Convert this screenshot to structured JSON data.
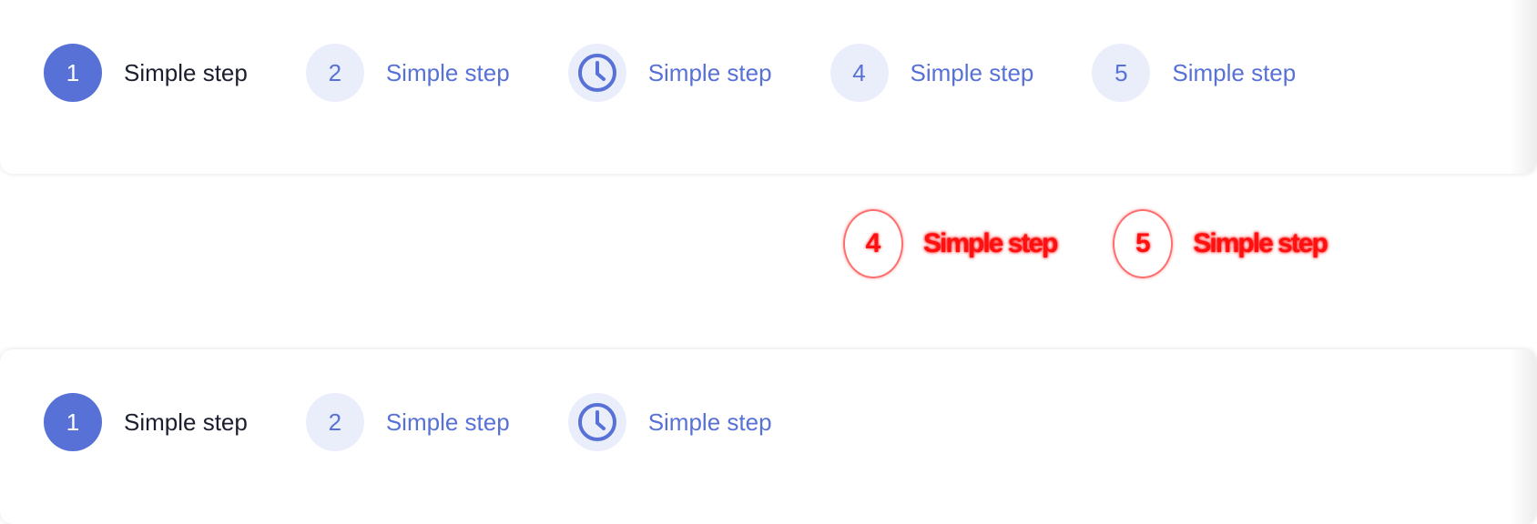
{
  "stepper_top": {
    "steps": [
      {
        "badge": "1",
        "label": "Simple step",
        "state": "active",
        "icon": null
      },
      {
        "badge": "2",
        "label": "Simple step",
        "state": "inactive",
        "icon": null
      },
      {
        "badge": "",
        "label": "Simple step",
        "state": "inactive",
        "icon": "clock-icon"
      },
      {
        "badge": "4",
        "label": "Simple step",
        "state": "inactive",
        "icon": null
      },
      {
        "badge": "5",
        "label": "Simple step",
        "state": "inactive",
        "icon": null
      }
    ]
  },
  "ghost_row": {
    "steps": [
      {
        "badge": "4",
        "label": "Simple step"
      },
      {
        "badge": "5",
        "label": "Simple step"
      }
    ]
  },
  "stepper_bottom": {
    "steps": [
      {
        "badge": "1",
        "label": "Simple step",
        "state": "active",
        "icon": null
      },
      {
        "badge": "2",
        "label": "Simple step",
        "state": "inactive",
        "icon": null
      },
      {
        "badge": "",
        "label": "Simple step",
        "state": "inactive",
        "icon": "clock-icon"
      }
    ]
  },
  "colors": {
    "accent": "#5771d6",
    "accent_soft": "#eaeefb",
    "text_dark": "#1b1e2e",
    "ghost_red": "#ff1010"
  }
}
